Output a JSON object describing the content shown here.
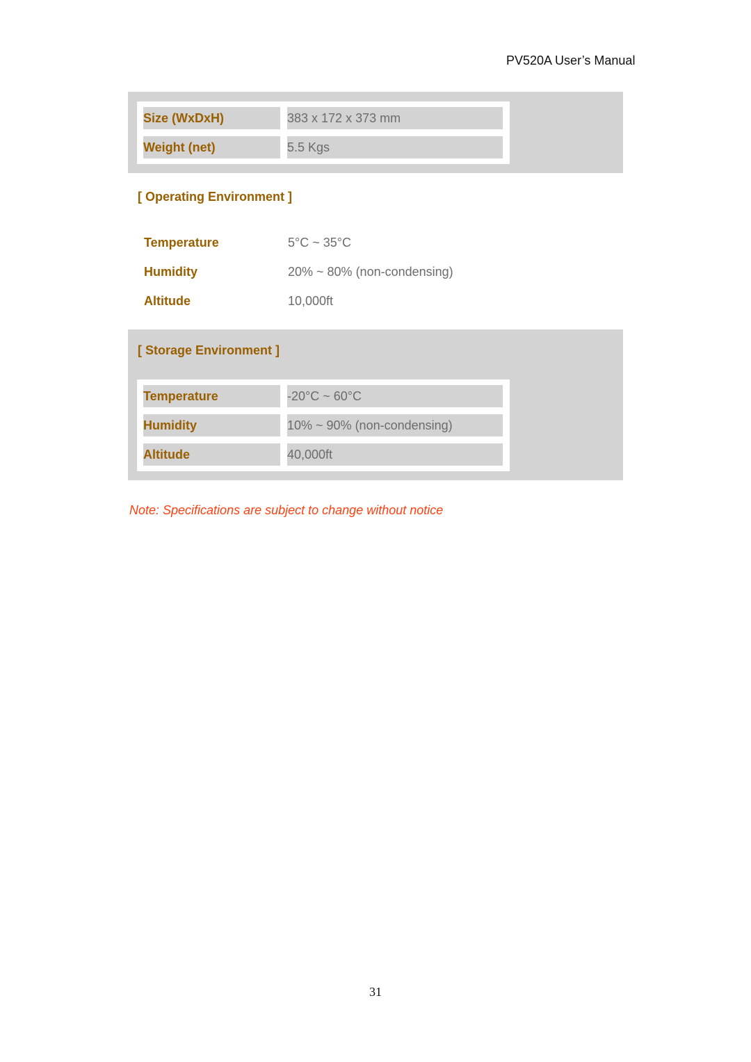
{
  "header": {
    "title": "PV520A User’s Manual"
  },
  "physical": {
    "rows": [
      {
        "label": "Size (WxDxH)",
        "value": "383 x 172 x 373 mm"
      },
      {
        "label": "Weight (net)",
        "value": "5.5 Kgs"
      }
    ]
  },
  "operating": {
    "heading": "[ Operating Environment ]",
    "rows": [
      {
        "label": "Temperature",
        "value": "5°C ~ 35°C"
      },
      {
        "label": "Humidity",
        "value": "20% ~ 80% (non-condensing)"
      },
      {
        "label": "Altitude",
        "value": "10,000ft"
      }
    ]
  },
  "storage": {
    "heading": "[ Storage Environment ]",
    "rows": [
      {
        "label": "Temperature",
        "value": "-20°C ~ 60°C"
      },
      {
        "label": "Humidity",
        "value": "10% ~ 90% (non-condensing)"
      },
      {
        "label": "Altitude",
        "value": "40,000ft"
      }
    ]
  },
  "note": "Note: Specifications are subject to change without notice",
  "page_number": "31",
  "colors": {
    "label": "#9a5f00",
    "value": "#6b6b6b",
    "note": "#ff4010",
    "panel": "#d3d3d3"
  }
}
